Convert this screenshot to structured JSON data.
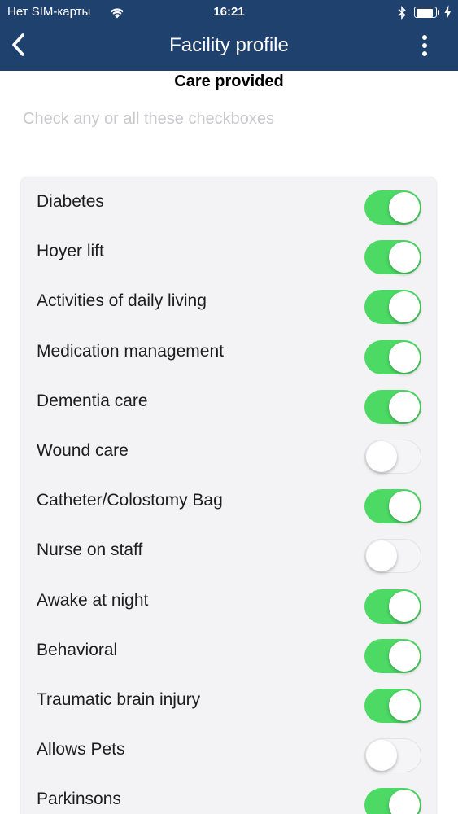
{
  "status_bar": {
    "carrier": "Нет SIM-карты",
    "time": "16:21"
  },
  "nav": {
    "title": "Facility profile",
    "back_icon": "chevron-left-icon",
    "menu_icon": "vertical-ellipsis-icon"
  },
  "section": {
    "title": "Care provided",
    "hint": "Check any or all these checkboxes"
  },
  "care_items": [
    {
      "label": "Diabetes",
      "enabled": true
    },
    {
      "label": "Hoyer lift",
      "enabled": true
    },
    {
      "label": "Activities of daily living",
      "enabled": true
    },
    {
      "label": "Medication management",
      "enabled": true
    },
    {
      "label": "Dementia care",
      "enabled": true
    },
    {
      "label": "Wound care",
      "enabled": false
    },
    {
      "label": "Catheter/Colostomy Bag",
      "enabled": true
    },
    {
      "label": "Nurse on staff",
      "enabled": false
    },
    {
      "label": "Awake at night",
      "enabled": true
    },
    {
      "label": "Behavioral",
      "enabled": true
    },
    {
      "label": "Traumatic brain injury",
      "enabled": true
    },
    {
      "label": "Allows Pets",
      "enabled": false
    },
    {
      "label": "Parkinsons",
      "enabled": true
    }
  ],
  "colors": {
    "nav_background": "#1f416e",
    "toggle_on": "#4cd964",
    "hint_text": "#c9c9cd"
  }
}
